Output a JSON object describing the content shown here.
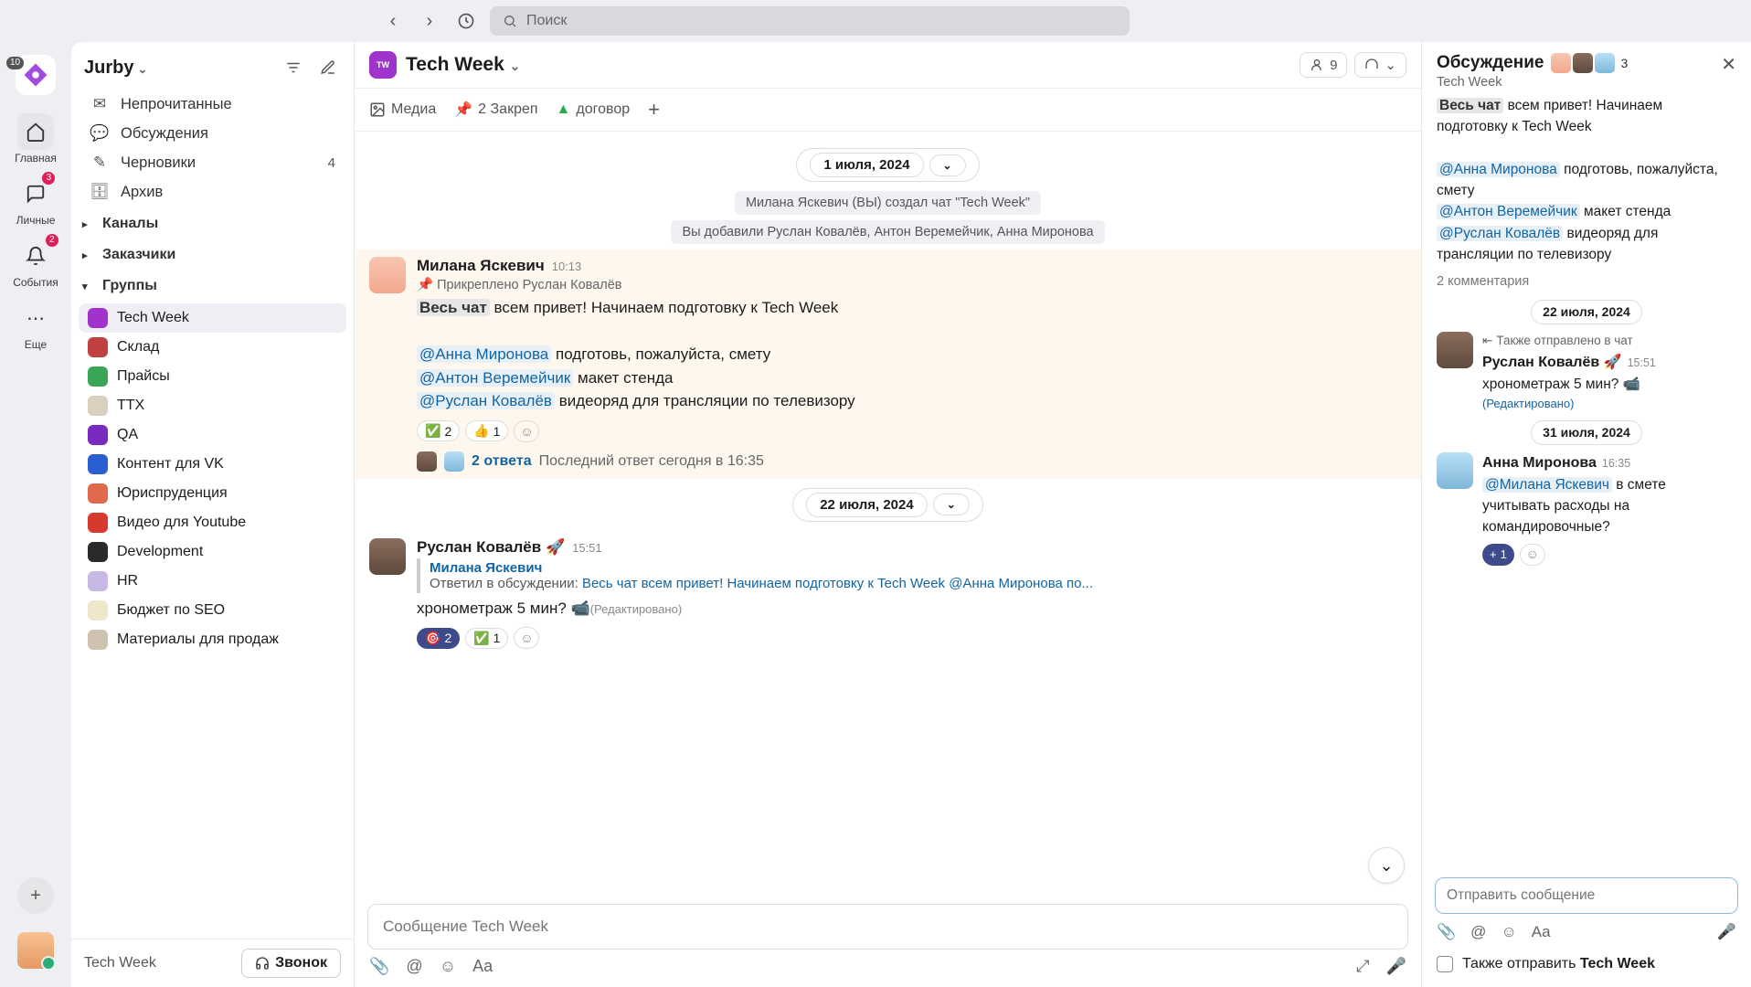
{
  "search": {
    "placeholder": "Поиск"
  },
  "rail": {
    "badge_logo": "10",
    "items": [
      {
        "label": "Главная"
      },
      {
        "label": "Личные",
        "badge": "3"
      },
      {
        "label": "События",
        "badge": "2"
      },
      {
        "label": "Еще"
      }
    ]
  },
  "workspace": {
    "name": "Jurby"
  },
  "sidebar": {
    "top": [
      {
        "label": "Непрочитанные"
      },
      {
        "label": "Обсуждения"
      },
      {
        "label": "Черновики",
        "count": "4"
      },
      {
        "label": "Архив"
      }
    ],
    "sections": {
      "channels": "Каналы",
      "customers": "Заказчики",
      "groups": "Группы"
    },
    "groups": [
      {
        "label": "Tech Week",
        "color": "#a033cc",
        "active": true
      },
      {
        "label": "Склад",
        "color": "#c04040"
      },
      {
        "label": "Прайсы",
        "color": "#3aa655"
      },
      {
        "label": "ТТХ",
        "color": "#d9d0c0"
      },
      {
        "label": "QA",
        "color": "#7a2bbf"
      },
      {
        "label": "Контент для VK",
        "color": "#2a5fd1"
      },
      {
        "label": "Юриспруденция",
        "color": "#e06a4b"
      },
      {
        "label": "Видео для Youtube",
        "color": "#d63a2f"
      },
      {
        "label": "Development",
        "color": "#2a2a2a"
      },
      {
        "label": "HR",
        "color": "#c7b8e6"
      },
      {
        "label": "Бюджет по SEO",
        "color": "#efe7cc"
      },
      {
        "label": "Материалы для продаж",
        "color": "#d0c2b0"
      }
    ],
    "footer_chat": "Tech Week",
    "call": "Звонок"
  },
  "channel": {
    "title": "Tech Week",
    "members": "9",
    "tabs": {
      "media": "Медиа",
      "pins": "2 Закреп",
      "doc": "договор"
    }
  },
  "dates": {
    "d1": "1 июля, 2024",
    "d2": "22 июля, 2024",
    "d3": "31 июля, 2024"
  },
  "system": {
    "created": "Милана Яскевич (ВЫ) создал чат \"Tech Week\"",
    "added": "Вы добавили Руслан Ковалёв, Антон Веремейчик, Анна Миронова"
  },
  "msg1": {
    "author": "Милана Яскевич",
    "time": "10:13",
    "pin": "Прикреплено Руслан Ковалёв",
    "tag_all": "Весь чат",
    "line1": "всем привет! Начинаем подготовку к Tech Week",
    "m1_tag": "@Анна Миронова",
    "m1_text": "подготовь, пожалуйста, смету",
    "m2_tag": "@Антон Веремейчик",
    "m2_text": "макет стенда",
    "m3_tag": "@Руслан Ковалёв",
    "m3_text": "видеоряд для трансляции по телевизору",
    "react1": "2",
    "react2": "1",
    "replies": "2 ответа",
    "replies_meta": "Последний ответ сегодня в 16:35"
  },
  "msg2": {
    "author": "Руслан Ковалёв 🚀",
    "time": "15:51",
    "quote_name": "Милана Яскевич",
    "quote_pre": "Ответил в обсуждении:",
    "quote_text": "Весь чат всем привет! Начинаем подготовку к Tech Week @Анна Миронова по...",
    "text": "хронометраж 5 мин? 📹",
    "edited": "(Редактировано)",
    "react1": "2",
    "react2": "1"
  },
  "composer": {
    "placeholder": "Сообщение Tech Week"
  },
  "thread": {
    "title": "Обсуждение",
    "subtitle": "Tech Week",
    "count": "3",
    "comments": "2 комментария",
    "sent_in_chat": "Также отправлено в чат",
    "r_author": "Руслан Ковалёв 🚀",
    "r_time": "15:51",
    "r_text": "хронометраж 5 мин? 📹",
    "r_edited": "(Редактировано)",
    "a_author": "Анна Миронова",
    "a_time": "16:35",
    "a_tag": "@Милана Яскевич",
    "a_text": "в смете учитывать расходы на командировочные?",
    "a_react": "1",
    "composer_placeholder": "Отправить сообщение",
    "also_send_pre": "Также отправить",
    "also_send_target": "Tech Week"
  }
}
